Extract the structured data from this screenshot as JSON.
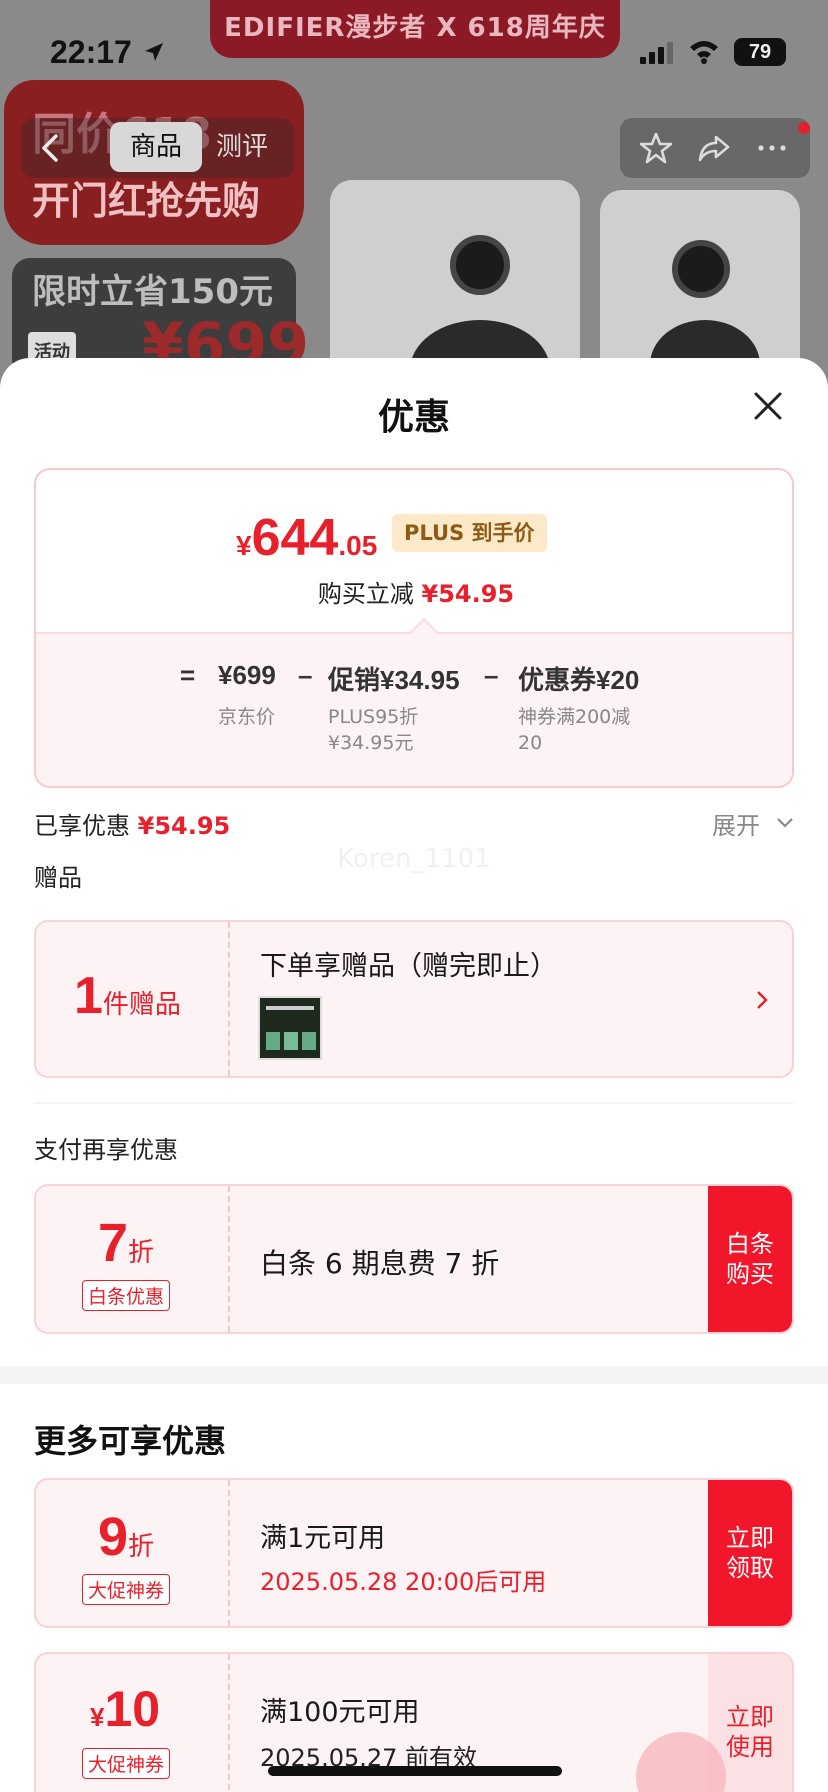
{
  "status_bar": {
    "time": "22:17",
    "battery": "79"
  },
  "background": {
    "brand_banner": "EDIFIER漫步者 X 618周年庆",
    "promo_line1": "同价618",
    "promo_line2": "开门红抢先购",
    "promo_line3": "限时立省150元",
    "promo_tag": "活动",
    "promo_price": "¥699",
    "tabs": {
      "goods": "商品",
      "review": "测评"
    }
  },
  "sheet": {
    "title": "优惠",
    "final_price": {
      "yen": "¥",
      "int": "644",
      "dec": ".05"
    },
    "plus_tag": "PLUS 到手价",
    "reduce_label": "购买立减",
    "reduce_amount": "¥54.95",
    "formula": {
      "eq": "=",
      "jd_price": "¥699",
      "minus1": "–",
      "promo": "促销¥34.95",
      "minus2": "–",
      "coupon": "优惠券¥20",
      "jd_price_label": "京东价",
      "promo_sub1": "PLUS95折",
      "promo_sub2": "¥34.95元",
      "coupon_sub1": "神券满200减",
      "coupon_sub2": "20"
    },
    "enjoyed_label": "已享优惠",
    "enjoyed_amount": "¥54.95",
    "expand_label": "展开",
    "watermark": "Koren_1101",
    "gift_section": "赠品",
    "gift": {
      "count": "1",
      "unit": "件赠品",
      "title": "下单享赠品（赠完即止）"
    },
    "pay_section": "支付再享优惠",
    "baitiao": {
      "discount": "7",
      "unit": "折",
      "tag": "白条优惠",
      "desc": "白条 6 期息费 7 折",
      "button": "白条购买"
    },
    "more_section": "更多可享优惠",
    "coupons": [
      {
        "discount": "9",
        "unit": "折",
        "tag": "大促神券",
        "title": "满1元可用",
        "time": "2025.05.28 20:00后可用",
        "button": "立即领取"
      },
      {
        "yen": "¥",
        "amount": "10",
        "tag": "大促神券",
        "title": "满100元可用",
        "time": "2025.05.27 前有效",
        "button": "立即使用"
      }
    ]
  },
  "colors": {
    "accent_red": "#e8202c",
    "button_red": "#f2162a",
    "plus_gold": "#8d5b14"
  },
  "icons": [
    "location-arrow-icon",
    "signal-icon",
    "wifi-icon",
    "back-icon",
    "star-icon",
    "share-icon",
    "more-icon",
    "close-icon",
    "chevron-down-icon",
    "chevron-right-icon"
  ]
}
